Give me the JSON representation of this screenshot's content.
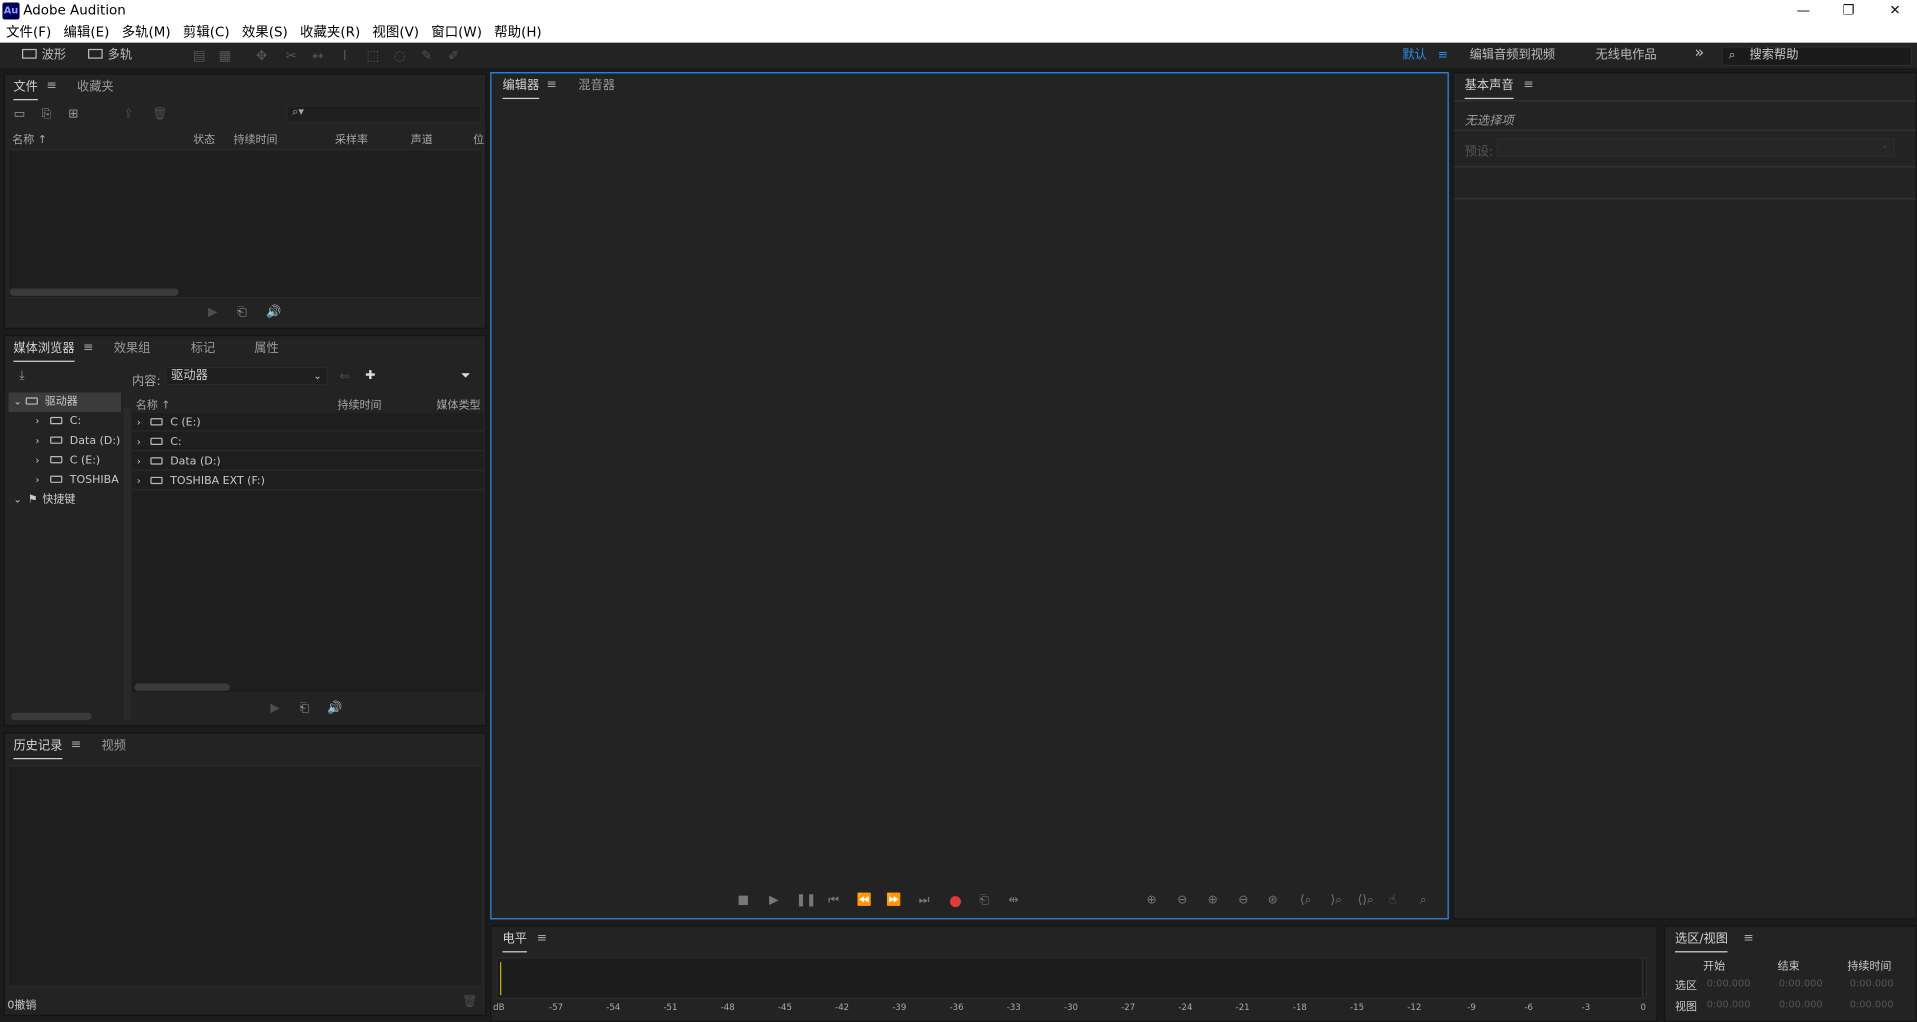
{
  "app": {
    "title": "Adobe Audition",
    "logo": "Au"
  },
  "window_controls": {
    "minimize": "—",
    "restore": "❐",
    "close": "✕"
  },
  "menu": [
    "文件(F)",
    "编辑(E)",
    "多轨(M)",
    "剪辑(C)",
    "效果(S)",
    "收藏夹(R)",
    "视图(V)",
    "窗口(W)",
    "帮助(H)"
  ],
  "toolbar": {
    "waveform_label": "波形",
    "multitrack_label": "多轨",
    "workspaces": {
      "default": "默认",
      "edit_audio_to_video": "编辑音频到视频",
      "radio": "无线电作品",
      "more": "»"
    },
    "search_placeholder": "搜索帮助"
  },
  "files_panel": {
    "tabs": [
      "文件",
      "收藏夹"
    ],
    "columns": [
      "名称 ↑",
      "状态",
      "持续时间",
      "采样率",
      "声道",
      "位"
    ]
  },
  "media_browser": {
    "tabs": [
      "媒体浏览器",
      "效果组",
      "标记",
      "属性"
    ],
    "content_label": "内容:",
    "content_value": "驱动器",
    "tree": [
      {
        "label": "驱动器",
        "expanded": true
      },
      {
        "label": "C:"
      },
      {
        "label": "Data (D:)"
      },
      {
        "label": "C (E:)"
      },
      {
        "label": "TOSHIBA"
      },
      {
        "label": "快捷键",
        "expanded": true
      }
    ],
    "columns": [
      "名称 ↑",
      "持续时间",
      "媒体类型"
    ],
    "rows": [
      "C (E:)",
      "C:",
      "Data (D:)",
      "TOSHIBA EXT (F:)"
    ]
  },
  "history_panel": {
    "tabs": [
      "历史记录",
      "视频"
    ],
    "undo_status": "0撤销"
  },
  "editor_panel": {
    "tabs": [
      "编辑器",
      "混音器"
    ]
  },
  "essential_sound": {
    "title": "基本声音",
    "no_selection": "无选择项",
    "preset_label": "预设:"
  },
  "level_meter": {
    "title": "电平",
    "ticks": [
      "dB",
      "-57",
      "-54",
      "-51",
      "-48",
      "-45",
      "-42",
      "-39",
      "-36",
      "-33",
      "-30",
      "-27",
      "-24",
      "-21",
      "-18",
      "-15",
      "-12",
      "-9",
      "-6",
      "-3",
      "0"
    ]
  },
  "selection_view": {
    "title": "选区/视图",
    "columns": [
      "开始",
      "结束",
      "持续时间"
    ],
    "rows": [
      {
        "label": "选区",
        "start": "0:00.000",
        "end": "0:00.000",
        "duration": "0:00.000"
      },
      {
        "label": "视图",
        "start": "0:00.000",
        "end": "0:00.000",
        "duration": "0:00.000"
      }
    ]
  },
  "colors": {
    "accent": "#2d8ceb",
    "record": "#e03a3a",
    "meter_marker": "#c8b400",
    "background": "#232323"
  }
}
